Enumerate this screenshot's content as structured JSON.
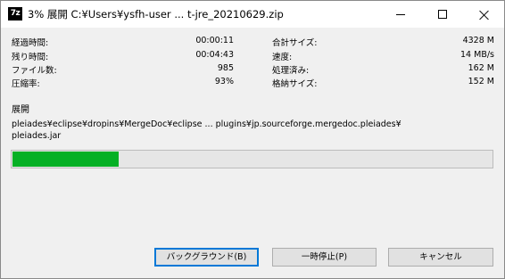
{
  "window": {
    "app_icon_text": "7z",
    "title": "3% 展開 C:¥Users¥ysfh-user ... t-jre_20210629.zip"
  },
  "stats_left": [
    {
      "label": "経過時間:",
      "value": "00:00:11"
    },
    {
      "label": "残り時間:",
      "value": "00:04:43"
    },
    {
      "label": "ファイル数:",
      "value": "985"
    },
    {
      "label": "圧縮率:",
      "value": "93%"
    }
  ],
  "stats_right": [
    {
      "label": "合計サイズ:",
      "value": "4328 M"
    },
    {
      "label": "速度:",
      "value": "14 MB/s"
    },
    {
      "label": "処理済み:",
      "value": "162 M"
    },
    {
      "label": "格納サイズ:",
      "value": "152 M"
    }
  ],
  "operation": {
    "label": "展開",
    "path_line1": "pleiades¥eclipse¥dropins¥MergeDoc¥eclipse ... plugins¥jp.sourceforge.mergedoc.pleiades¥",
    "path_line2": "pleiades.jar"
  },
  "progress": {
    "fraction": 0.03,
    "color": "#06b025"
  },
  "buttons": {
    "background": "バックグラウンド(B)",
    "pause": "一時停止(P)",
    "cancel": "キャンセル"
  }
}
